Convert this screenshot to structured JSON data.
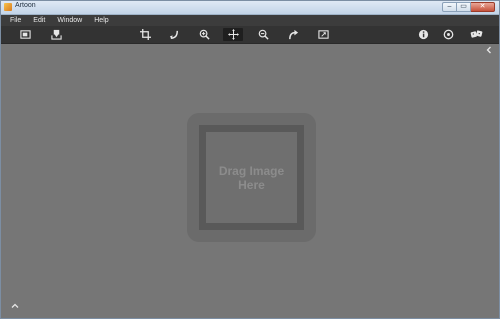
{
  "window": {
    "title": "Artoon",
    "controls": {
      "minimize": "–",
      "maximize": "▭",
      "close": "✕"
    }
  },
  "menu": {
    "items": [
      {
        "label": "File"
      },
      {
        "label": "Edit"
      },
      {
        "label": "Window"
      },
      {
        "label": "Help"
      }
    ]
  },
  "toolbar": {
    "icons": [
      "open-image-icon",
      "save-export-icon",
      "crop-icon",
      "rotate-left-icon",
      "zoom-in-icon",
      "move-pan-icon",
      "zoom-out-icon",
      "redo-icon",
      "fit-screen-icon",
      "info-icon",
      "settings-icon",
      "effects-icon"
    ],
    "active": "move-pan-icon"
  },
  "canvas": {
    "drop_text": "Drag Image\nHere"
  },
  "colors": {
    "titlebar": "#d3e0ee",
    "menubar": "#3c3c3c",
    "toolbar": "#333333",
    "canvas": "#767676",
    "drop_zone": "#6b6b6b",
    "drop_frame": "#595959",
    "drop_text": "#8c8c8c"
  }
}
